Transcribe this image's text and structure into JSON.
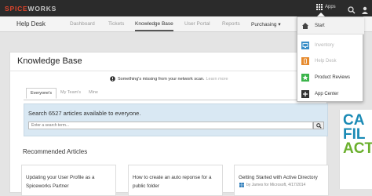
{
  "topbar": {
    "logo_a": "SPICE",
    "logo_b": "WORKS",
    "apps_label": "Apps",
    "icons": [
      "apps-grid-icon",
      "search-icon",
      "user-icon"
    ]
  },
  "nav": {
    "title": "Help Desk",
    "items": [
      "Dashboard",
      "Tickets",
      "Knowledge Base",
      "User Portal",
      "Reports",
      "Purchasing ▾"
    ]
  },
  "apps_menu": {
    "items": [
      {
        "label": "Start",
        "icon": "home-icon",
        "color": "#444444"
      },
      {
        "label": "Inventory",
        "icon": "monitor-icon",
        "color": "#3a8fc8"
      },
      {
        "label": "Help Desk",
        "icon": "phone-icon",
        "color": "#e68a2e"
      },
      {
        "label": "Product Reviews",
        "icon": "star-icon",
        "color": "#3bb44a"
      },
      {
        "label": "App Center",
        "icon": "plus-icon",
        "color": "#333333"
      }
    ]
  },
  "page": {
    "title": "Knowledge Base",
    "notice": "Something's missing from your network scan.",
    "notice_link": "Learn more"
  },
  "tabs": [
    "Everyone's",
    "My Team's",
    "Mine"
  ],
  "search": {
    "title": "Search 6527 articles available to everyone.",
    "placeholder": "Enter a search term..."
  },
  "recommended": {
    "title": "Recommended Articles",
    "cards": [
      {
        "title": "Updating your User Profile as a Spiceworks Partner",
        "meta": ""
      },
      {
        "title": "How to create an auto reponse for a public folder",
        "meta": ""
      },
      {
        "title": "Getting Started with Active Directory",
        "meta": "by James for Microsoft, 4/17/2014"
      }
    ]
  },
  "ad": {
    "lines": [
      "CA",
      "FIL",
      "ACT"
    ],
    "colors": [
      "#1a8ab5",
      "#1a8ab5",
      "#6bb02e"
    ]
  },
  "colors": {
    "accent": "#e0452c",
    "topbar": "#2b2b2b",
    "search_bg": "#d9e8f3"
  }
}
